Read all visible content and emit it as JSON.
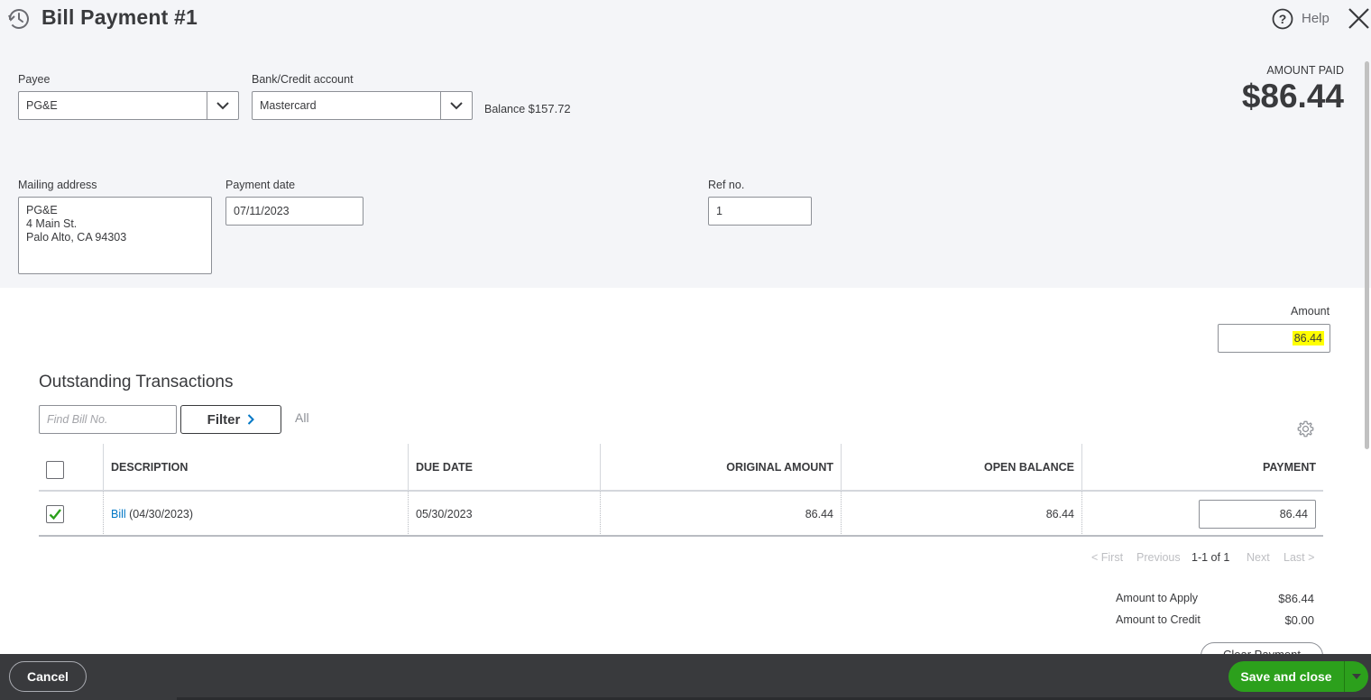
{
  "header": {
    "title": "Bill Payment #1",
    "help_label": "Help",
    "history_icon": "history-icon",
    "help_icon": "question-circle-icon",
    "close_icon": "close-icon"
  },
  "form": {
    "payee_label": "Payee",
    "payee_value": "PG&E",
    "bank_label": "Bank/Credit account",
    "bank_value": "Mastercard",
    "balance_label": "Balance",
    "balance_value": "$157.72",
    "mailing_label": "Mailing address",
    "mailing_lines": [
      "PG&E",
      "4 Main St.",
      "Palo Alto, CA  94303"
    ],
    "payment_date_label": "Payment date",
    "payment_date_value": "07/11/2023",
    "ref_label": "Ref no.",
    "ref_value": "1"
  },
  "amount_paid": {
    "label": "AMOUNT PAID",
    "value": "$86.44"
  },
  "amount": {
    "label": "Amount",
    "value": "86.44",
    "highlight_color": "#ffff00"
  },
  "outstanding": {
    "title": "Outstanding Transactions",
    "find_placeholder": "Find Bill No.",
    "filter_label": "Filter",
    "filter_scope": "All",
    "gear_icon": "gear-icon",
    "columns": [
      "DESCRIPTION",
      "DUE DATE",
      "ORIGINAL AMOUNT",
      "OPEN BALANCE",
      "PAYMENT"
    ],
    "rows": [
      {
        "checked": true,
        "description_link": "Bill",
        "description_rest": " (04/30/2023)",
        "due_date": "05/30/2023",
        "original_amount": "86.44",
        "open_balance": "86.44",
        "payment": "86.44"
      }
    ],
    "pager": {
      "first": "< First",
      "previous": "Previous",
      "range": "1-1 of 1",
      "next": "Next",
      "last": "Last >"
    }
  },
  "summary": {
    "apply_label": "Amount to Apply",
    "apply_value": "$86.44",
    "credit_label": "Amount to Credit",
    "credit_value": "$0.00",
    "clear_label": "Clear Payment"
  },
  "footer": {
    "cancel_label": "Cancel",
    "save_label": "Save and close"
  },
  "colors": {
    "accent_green": "#2ca01c",
    "link_blue": "#0077c5",
    "footer_bg": "#393a3d",
    "panel_bg": "#f4f5f8"
  }
}
